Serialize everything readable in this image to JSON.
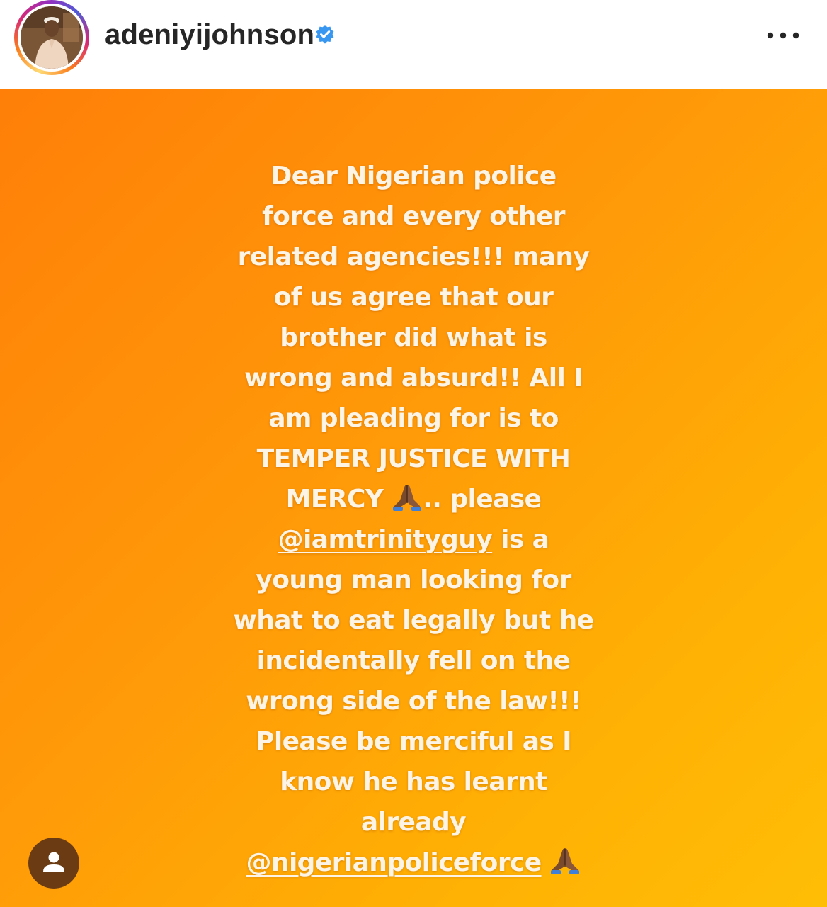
{
  "header": {
    "username": "adeniyijohnson",
    "verified": true,
    "avatar_icon": "profile-photo",
    "more_icon": "more-horizontal-icon"
  },
  "story": {
    "background_colors": [
      "#ff7f08",
      "#ffbe06"
    ],
    "text_color": "#fdf4e6",
    "line1": "Dear Nigerian police",
    "line2": "force and every other",
    "line3": "related agencies!!! many",
    "line4": "of us agree that our",
    "line5": "brother did what is",
    "line6": "wrong and absurd!! All I",
    "line7": "am pleading for is to",
    "line8": "TEMPER JUSTICE WITH",
    "line9_before": "MERCY ",
    "line9_after": ".. please",
    "line10_mention": "@iamtrinityguy",
    "line10_after": " is a",
    "line11": "young man looking for",
    "line12": "what to eat legally but he",
    "line13": "incidentally fell on the",
    "line14": "wrong side of the law!!!",
    "line15": "Please be merciful as I",
    "line16": "know he has learnt",
    "line17": "already",
    "line18_mention": "@nigerianpoliceforce",
    "emoji": "folded-hands"
  },
  "overlay": {
    "user_icon": "user-icon"
  }
}
